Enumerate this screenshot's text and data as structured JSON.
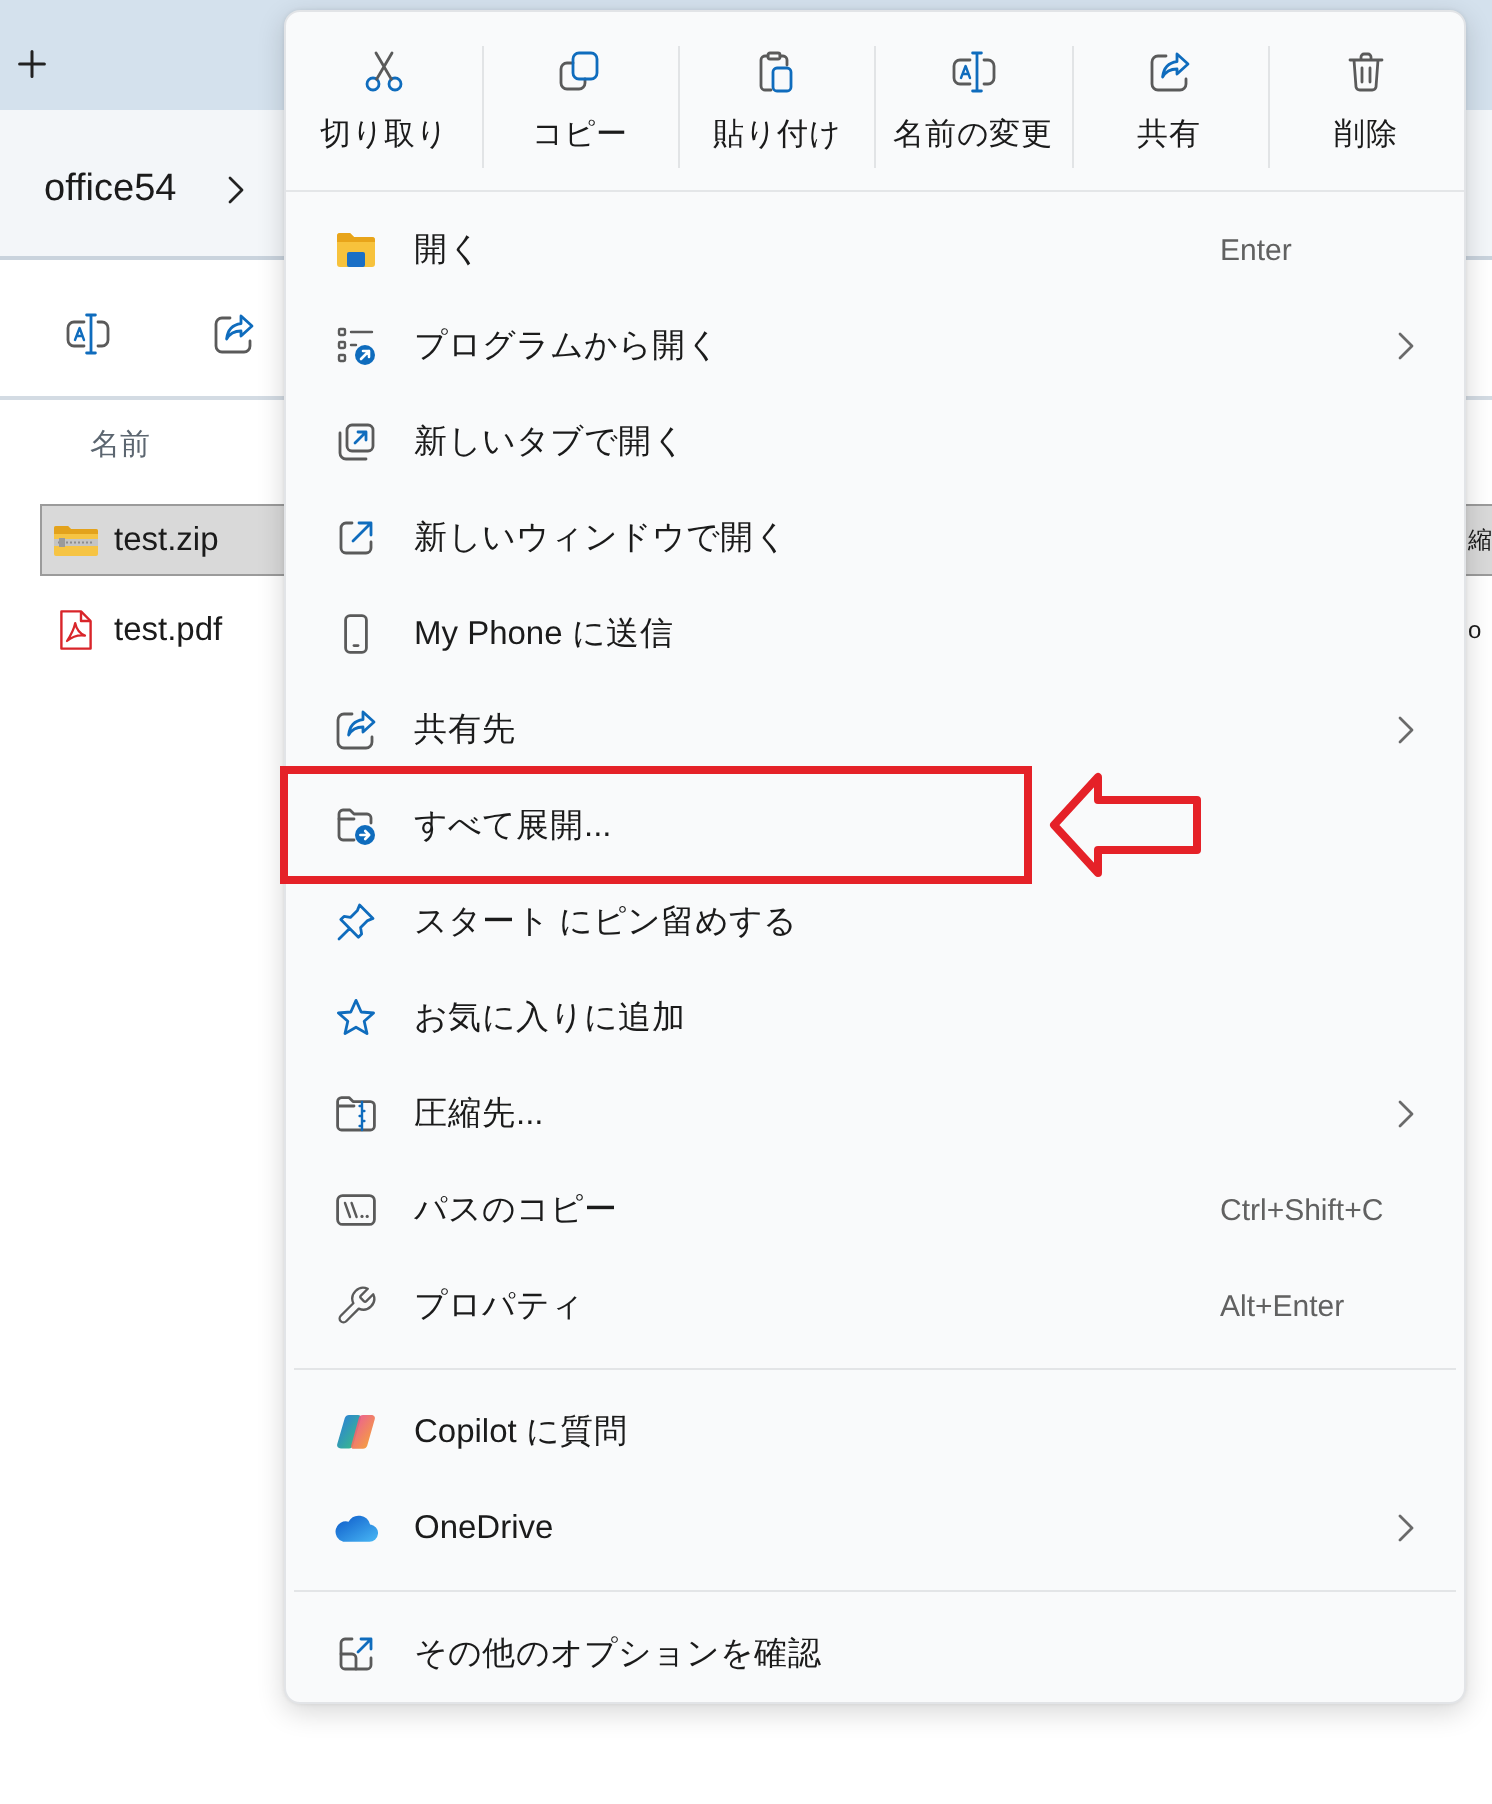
{
  "address_bar": {
    "folder": "office54"
  },
  "file_list": {
    "columns": [
      {
        "label": "名前"
      }
    ],
    "rows": [
      {
        "kind": "zip",
        "name": "test.zip",
        "selected": true,
        "column_3": "縮"
      },
      {
        "kind": "pdf",
        "name": "test.pdf",
        "selected": false,
        "column_3": "o"
      }
    ]
  },
  "context_menu": {
    "actions": [
      {
        "label": "切り取り"
      },
      {
        "label": "コピー"
      },
      {
        "label": "貼り付け"
      },
      {
        "label": "名前の変更"
      },
      {
        "label": "共有"
      },
      {
        "label": "削除"
      }
    ],
    "sections": [
      {
        "items": [
          {
            "label": "開く",
            "shortcut": "Enter",
            "submenu": false,
            "highlighted": false
          },
          {
            "label": "プログラムから開く",
            "submenu": true,
            "highlighted": false
          },
          {
            "label": "新しいタブで開く",
            "submenu": false,
            "highlighted": false
          },
          {
            "label": "新しいウィンドウで開く",
            "submenu": false,
            "highlighted": false
          },
          {
            "label": "My Phone に送信",
            "submenu": false,
            "highlighted": false
          },
          {
            "label": "共有先",
            "submenu": true,
            "highlighted": false
          },
          {
            "label": "すべて展開...",
            "submenu": false,
            "highlighted": true
          },
          {
            "label": "スタート にピン留めする",
            "submenu": false,
            "highlighted": false
          },
          {
            "label": "お気に入りに追加",
            "submenu": false,
            "highlighted": false
          },
          {
            "label": "圧縮先...",
            "submenu": true,
            "highlighted": false
          },
          {
            "label": "パスのコピー",
            "shortcut": "Ctrl+Shift+C",
            "submenu": false,
            "highlighted": false
          },
          {
            "label": "プロパティ",
            "shortcut": "Alt+Enter",
            "submenu": false,
            "highlighted": false
          }
        ]
      },
      {
        "items": [
          {
            "label": "Copilot に質問",
            "submenu": false,
            "highlighted": false
          },
          {
            "label": "OneDrive",
            "submenu": true,
            "highlighted": false
          }
        ]
      },
      {
        "items": [
          {
            "label": "その他のオプションを確認",
            "submenu": false,
            "highlighted": false
          }
        ]
      }
    ]
  }
}
